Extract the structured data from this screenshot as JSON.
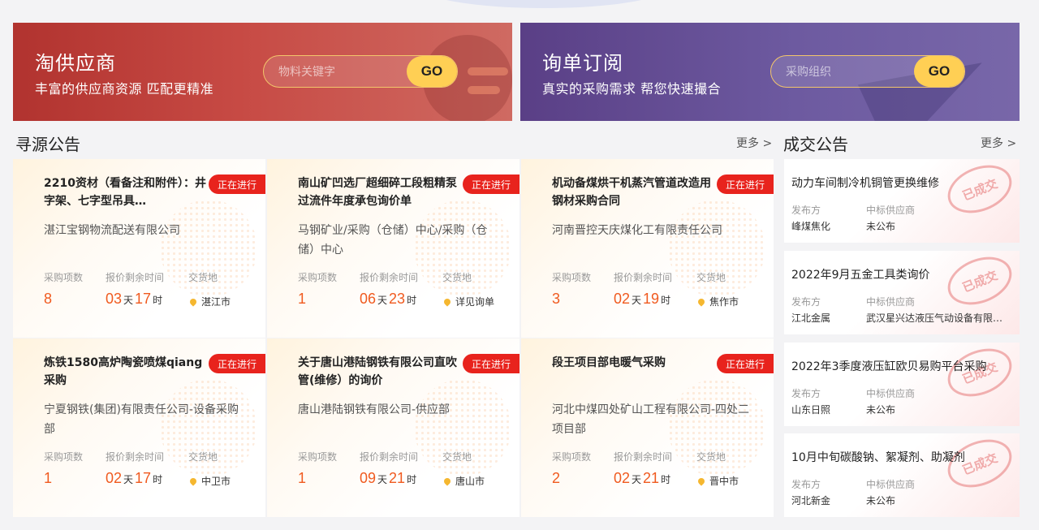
{
  "banners": {
    "supplier": {
      "title": "淘供应商",
      "subtitle": "丰富的供应商资源 匹配更精准",
      "placeholder": "物料关键字",
      "go": "GO"
    },
    "inquiry": {
      "title": "询单订阅",
      "subtitle": "真实的采购需求 帮您快速撮合",
      "placeholder": "采购组织",
      "go": "GO"
    }
  },
  "sourcing": {
    "title": "寻源公告",
    "more": "更多 >",
    "labels": {
      "items": "采购项数",
      "remaining": "报价剩余时间",
      "delivery": "交货地",
      "day": "天",
      "hour": "时"
    },
    "cards": [
      {
        "title": "2210资材（看备注和附件）：井字架、七字型吊具…",
        "status": "正在进行",
        "company": "湛江宝钢物流配送有限公司",
        "items": "8",
        "days": "03",
        "hours": "17",
        "place": "湛江市"
      },
      {
        "title": "南山矿凹选厂超细碎工段粗精泵过流件年度承包询价单",
        "status": "正在进行",
        "company": "马钢矿业/采购（仓储）中心/采购（仓储）中心",
        "items": "1",
        "days": "06",
        "hours": "23",
        "place": "详见询单"
      },
      {
        "title": "机动备煤烘干机蒸汽管道改造用钢材采购合同",
        "status": "正在进行",
        "company": "河南晋控天庆煤化工有限责任公司",
        "items": "3",
        "days": "02",
        "hours": "19",
        "place": "焦作市"
      },
      {
        "title": "炼铁1580高炉陶瓷喷煤qiang采购",
        "status": "正在进行",
        "company": "宁夏钢铁(集团)有限责任公司-设备采购部",
        "items": "1",
        "days": "02",
        "hours": "17",
        "place": "中卫市"
      },
      {
        "title": "关于唐山港陆钢铁有限公司直吹管(维修）的询价",
        "status": "正在进行",
        "company": "唐山港陆钢铁有限公司-供应部",
        "items": "1",
        "days": "09",
        "hours": "21",
        "place": "唐山市"
      },
      {
        "title": "段王项目部电暖气采购",
        "status": "正在进行",
        "company": "河北中煤四处矿山工程有限公司-四处二项目部",
        "items": "2",
        "days": "02",
        "hours": "21",
        "place": "晋中市"
      }
    ]
  },
  "deals": {
    "title": "成交公告",
    "more": "更多 >",
    "labels": {
      "publisher": "发布方",
      "winner": "中标供应商",
      "stamp": "已成交"
    },
    "items": [
      {
        "title": "动力车间制冷机铜管更换维修",
        "publisher": "峰煤焦化",
        "winner": "未公布"
      },
      {
        "title": "2022年9月五金工具类询价",
        "publisher": "江北金属",
        "winner": "武汉星兴达液压气动设备有限…"
      },
      {
        "title": "2022年3季度液压缸欧贝易购平台采购",
        "publisher": "山东日照",
        "winner": "未公布"
      },
      {
        "title": "10月中旬碳酸钠、絮凝剂、助凝剂",
        "publisher": "河北新金",
        "winner": "未公布"
      }
    ]
  }
}
